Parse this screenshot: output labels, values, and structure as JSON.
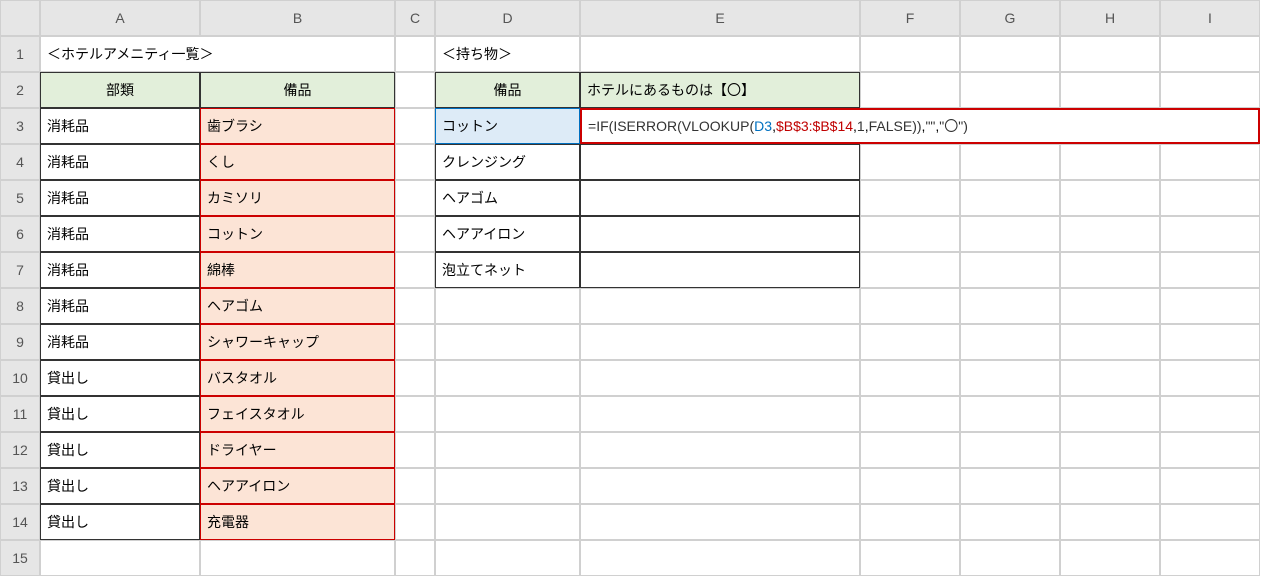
{
  "cols": [
    "",
    "A",
    "B",
    "C",
    "D",
    "E",
    "F",
    "G",
    "H",
    "I"
  ],
  "rows": [
    "1",
    "2",
    "3",
    "4",
    "5",
    "6",
    "7",
    "8",
    "9",
    "10",
    "11",
    "12",
    "13",
    "14",
    "15"
  ],
  "a1": "＜ホテルアメニティ一覧＞",
  "d1": "＜持ち物＞",
  "headers": {
    "a2": "部類",
    "b2": "備品",
    "d2": "備品",
    "e2": "ホテルにあるものは【〇】"
  },
  "tableA": [
    {
      "a": "消耗品",
      "b": "歯ブラシ"
    },
    {
      "a": "消耗品",
      "b": "くし"
    },
    {
      "a": "消耗品",
      "b": "カミソリ"
    },
    {
      "a": "消耗品",
      "b": "コットン"
    },
    {
      "a": "消耗品",
      "b": "綿棒"
    },
    {
      "a": "消耗品",
      "b": "ヘアゴム"
    },
    {
      "a": "消耗品",
      "b": "シャワーキャップ"
    },
    {
      "a": "貸出し",
      "b": "バスタオル"
    },
    {
      "a": "貸出し",
      "b": "フェイスタオル"
    },
    {
      "a": "貸出し",
      "b": "ドライヤー"
    },
    {
      "a": "貸出し",
      "b": "ヘアアイロン"
    },
    {
      "a": "貸出し",
      "b": "充電器"
    }
  ],
  "tableD": [
    "コットン",
    "クレンジング",
    "ヘアゴム",
    "ヘアアイロン",
    "泡立てネット"
  ],
  "formula": {
    "eq": "=",
    "if": "IF",
    "op": "(",
    "iserr": "ISERROR",
    "vlk": "VLOOKUP",
    "ref1": "D3",
    "c1": ",",
    "ref2": "$B$3:$B$14",
    "c2": ",",
    "one": "1",
    "c3": ",",
    "false": "FALSE",
    "cp1": ")",
    "cp2": ")",
    "c4": ",",
    "s1": "\"\"",
    "c5": ",",
    "s2": "\"〇\"",
    "cp3": ")"
  }
}
